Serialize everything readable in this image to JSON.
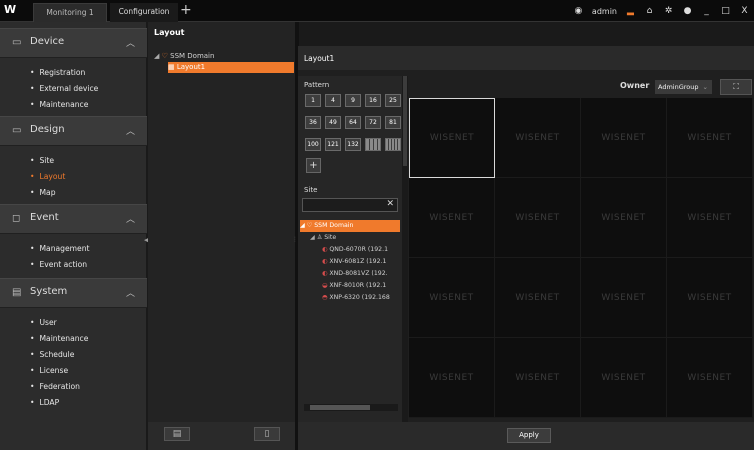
{
  "topbar": {
    "logo": "W",
    "tabs": [
      {
        "label": "Monitoring 1"
      },
      {
        "label": "Configuration"
      }
    ],
    "add_tab": "+",
    "user": "admin"
  },
  "sidebar": {
    "sections": [
      {
        "title": "Device",
        "icon": "device-icon",
        "items": [
          "Registration",
          "External device",
          "Maintenance"
        ]
      },
      {
        "title": "Design",
        "icon": "design-icon",
        "items": [
          "Site",
          "Layout",
          "Map"
        ]
      },
      {
        "title": "Event",
        "icon": "event-icon",
        "items": [
          "Management",
          "Event action"
        ]
      },
      {
        "title": "System",
        "icon": "system-icon",
        "items": [
          "User",
          "Maintenance",
          "Schedule",
          "License",
          "Federation",
          "LDAP"
        ]
      }
    ],
    "active_item": "Layout"
  },
  "layout_panel": {
    "title": "Layout",
    "tree": {
      "root": "SSM Domain",
      "child": "Layout1"
    }
  },
  "main": {
    "title": "Layout1",
    "pattern_label": "Pattern",
    "patterns": [
      "1",
      "4",
      "9",
      "16",
      "25",
      "36",
      "49",
      "64",
      "72",
      "81",
      "100",
      "121",
      "132",
      "",
      ""
    ],
    "add_label": "+",
    "site_label": "Site",
    "search_value": "",
    "site_tree": {
      "root": "SSM Domain",
      "site": "Site",
      "cameras": [
        "QND-6070R (192.1",
        "XNV-6081Z (192.1",
        "XND-8081VZ (192.",
        "XNF-8010R (192.1",
        "XNP-6320 (192.168"
      ]
    },
    "owner_label": "Owner",
    "owner_value": "AdminGroup",
    "grid_watermark": "WISENET",
    "apply_label": "Apply"
  },
  "colors": {
    "accent": "#f07a2c",
    "bg": "#1a1a1a"
  }
}
